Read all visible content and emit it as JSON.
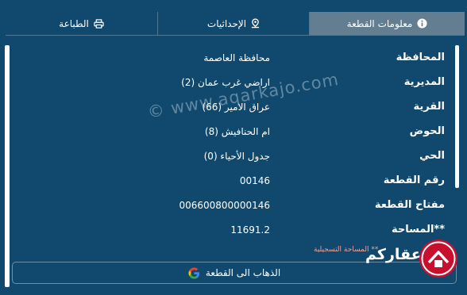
{
  "tabs": [
    {
      "label": "معلومات القطعة",
      "icon": "info-icon"
    },
    {
      "label": "الإحداثيات",
      "icon": "map-marker-icon"
    },
    {
      "label": "الطباعة",
      "icon": "printer-icon"
    }
  ],
  "rows": [
    {
      "label": "المحافظة",
      "value": "محافظة العاصمة"
    },
    {
      "label": "المديرية",
      "value": "اراضي غرب عمان (2)"
    },
    {
      "label": "القرية",
      "value": "عراق الامير (66)"
    },
    {
      "label": "الحوض",
      "value": "ام الحنافيش (8)"
    },
    {
      "label": "الحي",
      "value": "جدول الأحياء (0)"
    },
    {
      "label": "رقم القطعة",
      "value": "00146"
    },
    {
      "label": "مفتاح القطعة",
      "value": "006600800000146"
    },
    {
      "label": "**المساحة",
      "value": "11691.2"
    }
  ],
  "note": "** المساحة التسجيلية",
  "goto_button": {
    "label": "الذهاب الى القطعة",
    "icon": "google-icon"
  },
  "watermark": "© www.aqarkajo.com",
  "brand": {
    "text": "عقاركم"
  },
  "colors": {
    "background": "#10496d",
    "active_tab": "#647e91",
    "note": "#e8a3a3",
    "brand_red": "#c8102e"
  }
}
